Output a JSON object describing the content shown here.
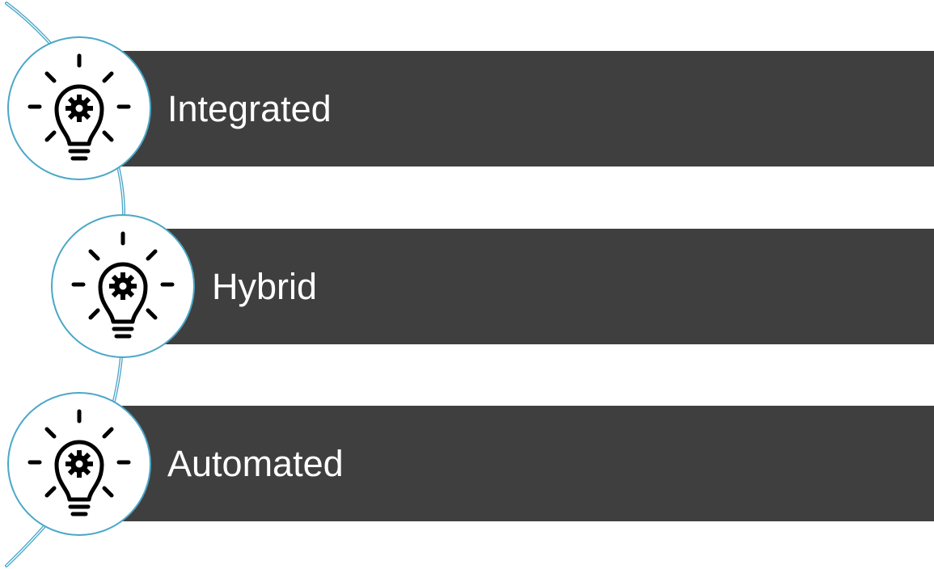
{
  "items": [
    {
      "label": "Integrated",
      "icon": "lightbulb-gear-icon"
    },
    {
      "label": "Hybrid",
      "icon": "lightbulb-gear-icon"
    },
    {
      "label": "Automated",
      "icon": "lightbulb-gear-icon"
    }
  ],
  "colors": {
    "bar": "#3f3f3f",
    "text": "#ffffff",
    "accent": "#4aa7c7"
  }
}
